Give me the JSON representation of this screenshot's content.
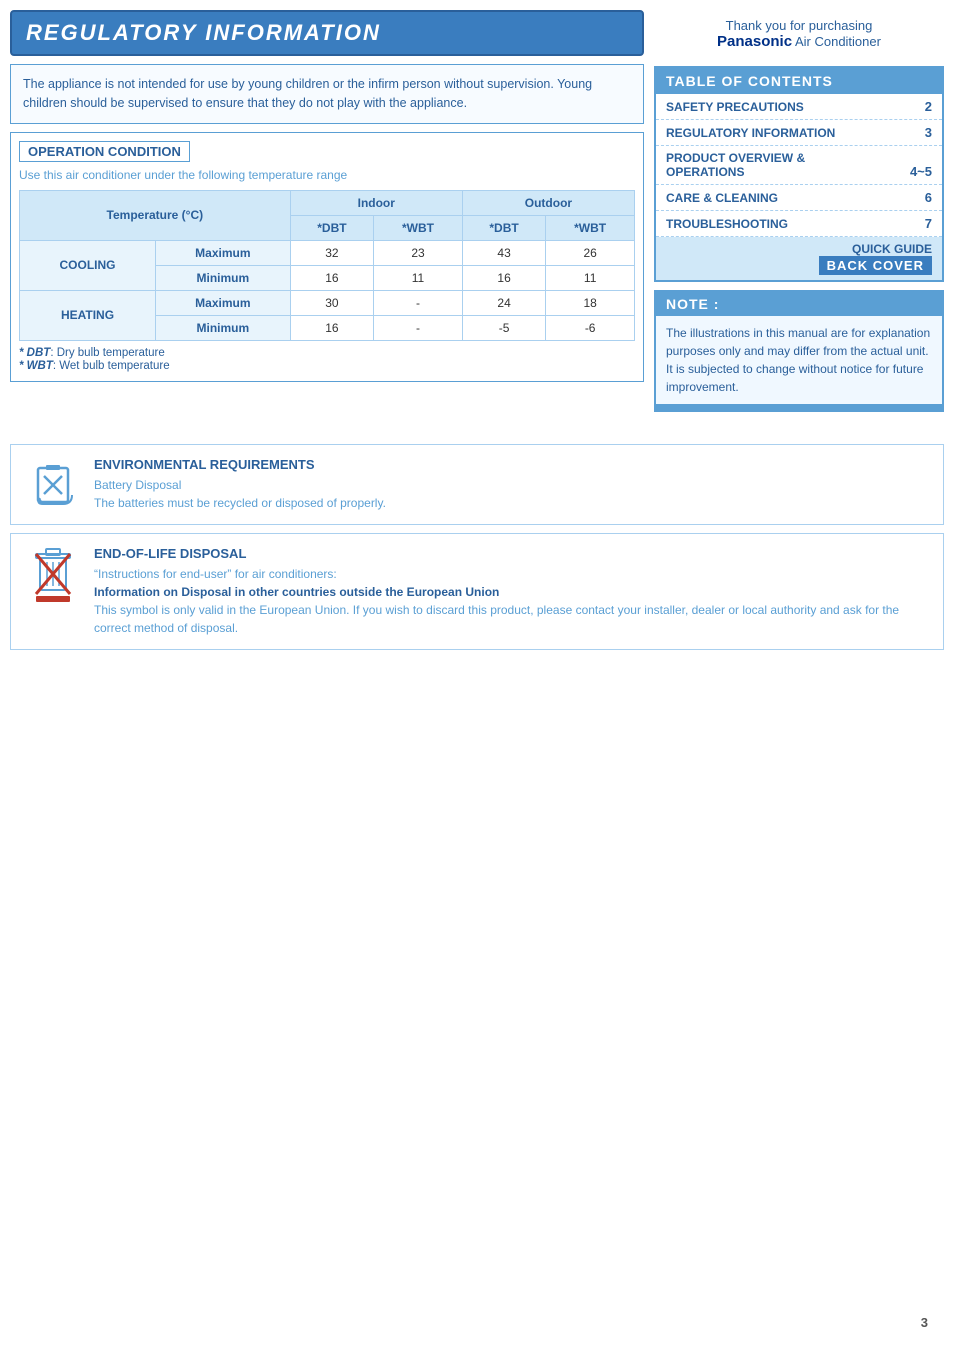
{
  "header": {
    "title": "REGULATORY INFORMATION"
  },
  "warning": {
    "text": "The appliance is not intended for use by young children or the infirm person without supervision. Young children should be supervised to ensure that they do not play with the appliance."
  },
  "operation": {
    "title": "OPERATION CONDITION",
    "subtitle": "Use this air conditioner under the following temperature range",
    "table": {
      "col_headers": [
        "Temperature (°C)",
        "Indoor",
        "Outdoor"
      ],
      "sub_headers": [
        "*DBT",
        "*WBT",
        "*DBT",
        "*WBT"
      ],
      "rows": [
        {
          "mode": "COOLING",
          "type": "Maximum",
          "indoor_dbt": "32",
          "indoor_wbt": "23",
          "outdoor_dbt": "43",
          "outdoor_wbt": "26"
        },
        {
          "mode": "COOLING",
          "type": "Minimum",
          "indoor_dbt": "16",
          "indoor_wbt": "11",
          "outdoor_dbt": "16",
          "outdoor_wbt": "11"
        },
        {
          "mode": "HEATING",
          "type": "Maximum",
          "indoor_dbt": "30",
          "indoor_wbt": "-",
          "outdoor_dbt": "24",
          "outdoor_wbt": "18"
        },
        {
          "mode": "HEATING",
          "type": "Minimum",
          "indoor_dbt": "16",
          "indoor_wbt": "-",
          "outdoor_dbt": "-5",
          "outdoor_wbt": "-6"
        }
      ]
    },
    "footnotes": [
      {
        "key": "* DBT",
        "value": ":  Dry bulb temperature"
      },
      {
        "key": "* WBT",
        "value": ":  Wet bulb temperature"
      }
    ]
  },
  "right_panel": {
    "thank_you": "Thank you for purchasing",
    "brand": "Panasonic",
    "product": "Air Conditioner",
    "toc_title": "TABLE OF CONTENTS",
    "toc_items": [
      {
        "label": "SAFETY PRECAUTIONS",
        "page": "2"
      },
      {
        "label": "REGULATORY INFORMATION",
        "page": "3"
      },
      {
        "label": "PRODUCT OVERVIEW & OPERATIONS",
        "page": "4~5"
      },
      {
        "label": "CARE & CLEANING",
        "page": "6"
      },
      {
        "label": "TROUBLESHOOTING",
        "page": "7"
      },
      {
        "label": "QUICK GUIDE",
        "page": "BACK COVER",
        "special": true
      }
    ],
    "note_title": "NOTE :",
    "note_text": "The illustrations in this manual are for explanation purposes only and may differ from the actual unit. It is subjected to change without notice for future improvement."
  },
  "environmental": {
    "title": "ENVIRONMENTAL REQUIREMENTS",
    "subtitle": "Battery Disposal",
    "text": "The batteries must be recycled or disposed of properly."
  },
  "disposal": {
    "title": "END-OF-LIFE DISPOSAL",
    "line1": "“Instructions for end-user” for air conditioners:",
    "bold_line": "Information on Disposal in other countries outside the European Union",
    "line2": "This symbol is only valid in the European Union. If you wish to discard this product, please contact your installer, dealer or local authority and ask for the correct method of disposal."
  },
  "page_number": "3"
}
